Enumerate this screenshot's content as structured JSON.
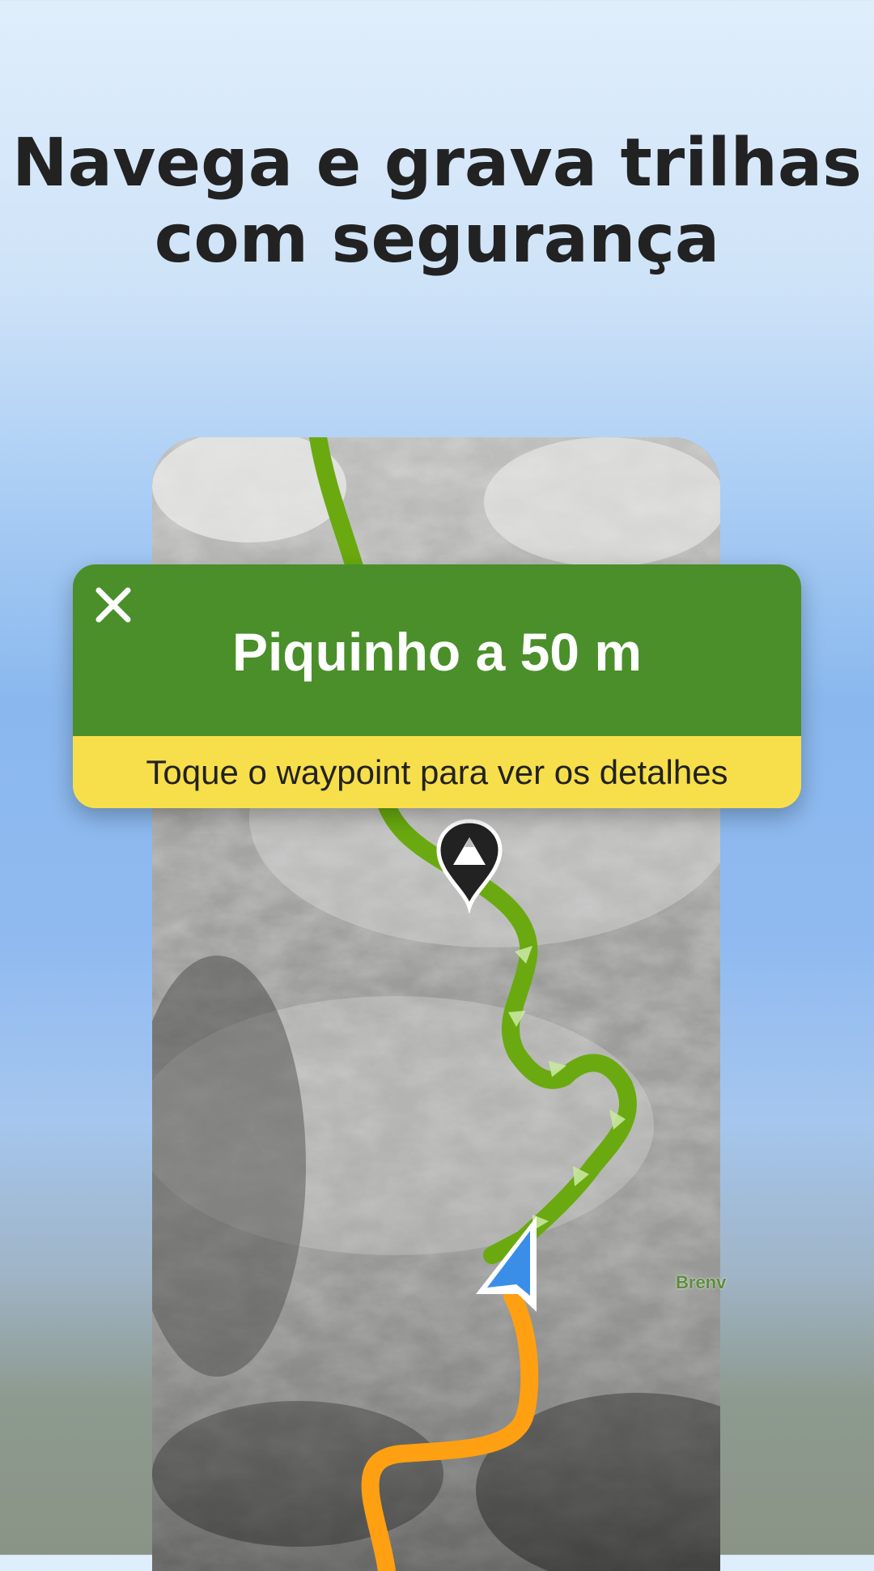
{
  "headline": {
    "line1": "Navega e grava trilhas",
    "line2": "com segurança"
  },
  "banner": {
    "title": "Piquinho a 50 m",
    "subtitle": "Toque o waypoint para ver os detalhes",
    "close_icon": "close-icon",
    "top_color": "#4a8f2a",
    "bottom_color": "#f7df4c"
  },
  "map": {
    "label": "Brenv",
    "track_color": "#6aaa10",
    "route_color": "#ffa012",
    "position_color": "#3a8ee8",
    "waypoint_icon": "mountain-pin-icon",
    "position_icon": "navigation-arrow-icon"
  }
}
